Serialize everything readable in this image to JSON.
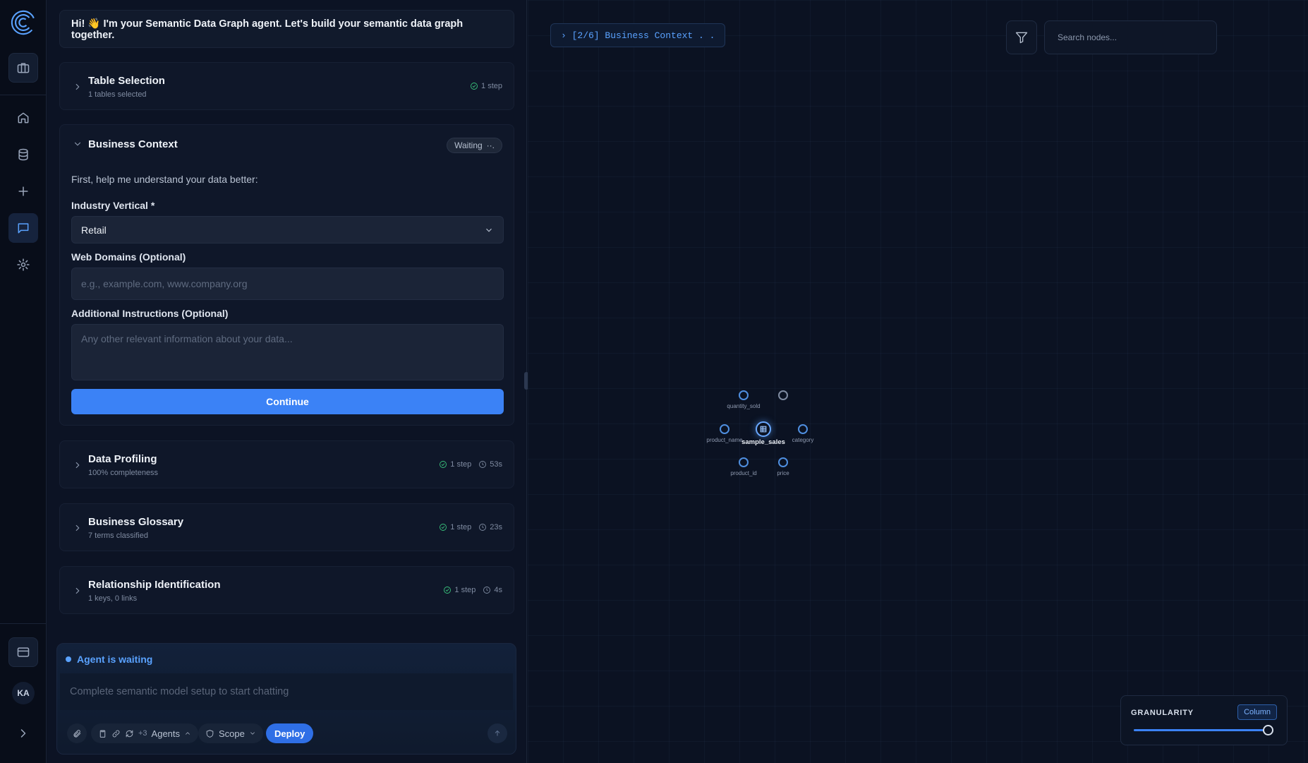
{
  "app": {
    "user_initials": "KA"
  },
  "chat": {
    "greeting": "Hi! 👋 I'm your Semantic Data Graph agent. Let's build your semantic data graph together.",
    "steps": {
      "table_selection": {
        "title": "Table Selection",
        "subtitle": "1 tables selected",
        "steps": "1 step"
      },
      "business_context": {
        "title": "Business Context",
        "status": "Waiting",
        "status_dots": "··.",
        "intro": "First, help me understand your data better:",
        "industry_label": "Industry Vertical *",
        "industry_value": "Retail",
        "domains_label": "Web Domains (Optional)",
        "domains_placeholder": "e.g., example.com, www.company.org",
        "instructions_label": "Additional Instructions (Optional)",
        "instructions_placeholder": "Any other relevant information about your data...",
        "continue_label": "Continue"
      },
      "data_profiling": {
        "title": "Data Profiling",
        "subtitle": "100% completeness",
        "steps": "1 step",
        "duration": "53s"
      },
      "business_glossary": {
        "title": "Business Glossary",
        "subtitle": "7 terms classified",
        "steps": "1 step",
        "duration": "23s"
      },
      "relationship_identification": {
        "title": "Relationship Identification",
        "subtitle": "1 keys, 0 links",
        "steps": "1 step",
        "duration": "4s"
      }
    },
    "composer": {
      "status": "Agent is waiting",
      "placeholder": "Complete semantic model setup to start chatting",
      "agents_extra": "+3",
      "agents_label": "Agents",
      "scope_label": "Scope",
      "deploy_label": "Deploy"
    }
  },
  "graph": {
    "step_indicator": "› [2/6] Business Context . .",
    "search_placeholder": "Search nodes...",
    "center_node": "sample_sales",
    "nodes": [
      "quantity_sold",
      "product_name",
      "category",
      "product_id",
      "price"
    ],
    "granularity": {
      "title": "GRANULARITY",
      "value": "Column",
      "level": 1.0
    }
  },
  "colors": {
    "accent": "#3b82f6",
    "link": "#5aa2ff",
    "success": "#3ac47d",
    "background": "#0b1222"
  }
}
